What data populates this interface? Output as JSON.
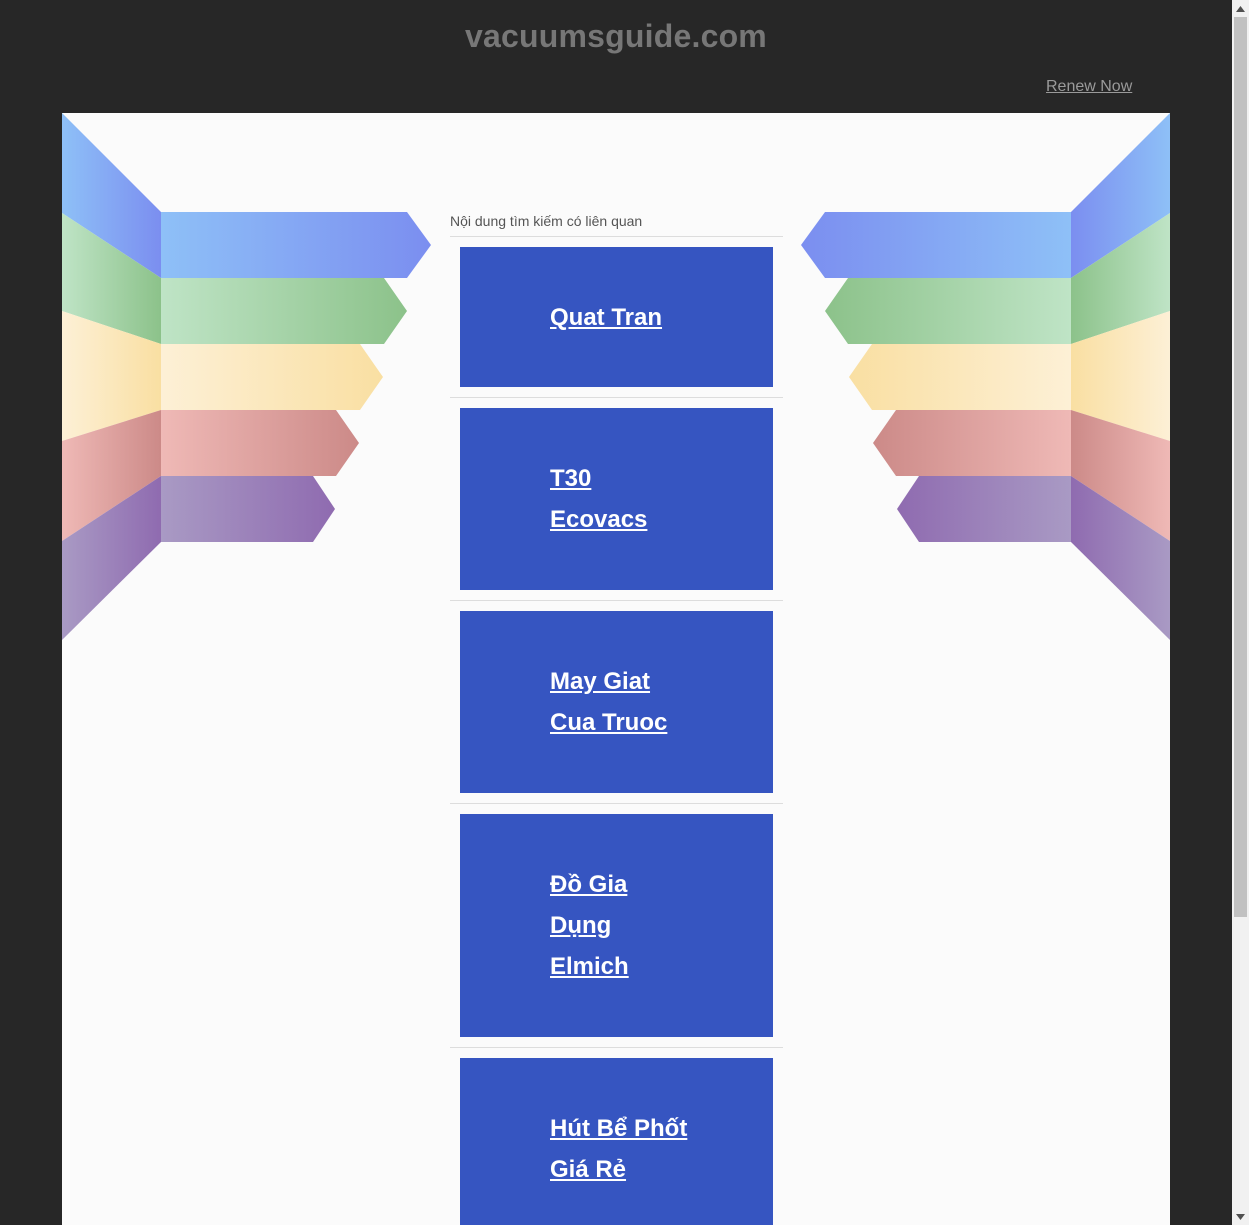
{
  "header": {
    "domain": "vacuumsguide.com",
    "renew_label": "Renew Now"
  },
  "results": {
    "heading": "Nội dung tìm kiếm có liên quan",
    "items": [
      {
        "lines": [
          "Quat Tran"
        ]
      },
      {
        "lines": [
          "T30",
          "Ecovacs"
        ]
      },
      {
        "lines": [
          "May Giat",
          "Cua Truoc"
        ]
      },
      {
        "lines": [
          "Đồ Gia",
          "Dụng",
          "Elmich"
        ]
      },
      {
        "lines": [
          "Hút Bể Phốt",
          "Giá Rẻ"
        ]
      }
    ]
  },
  "colors": {
    "page_background": "#272727",
    "panel_background": "#fbfbfb",
    "result_box": "#3655c1",
    "result_text": "#ffffff",
    "domain_text": "#777777",
    "renew_text": "#9a9a9a",
    "ribbon_blue": [
      "#8ec0f7",
      "#7b8ef0"
    ],
    "ribbon_green": [
      "#bfe4c6",
      "#8cc28a"
    ],
    "ribbon_yellow": [
      "#fdf0d6",
      "#f9dfa2"
    ],
    "ribbon_red": [
      "#efb9b6",
      "#cc8a88"
    ],
    "ribbon_purple": [
      "#a99ac4",
      "#8f6bb0"
    ]
  },
  "scrollbar": {
    "up_icon": "triangle-up-icon",
    "down_icon": "triangle-down-icon"
  }
}
